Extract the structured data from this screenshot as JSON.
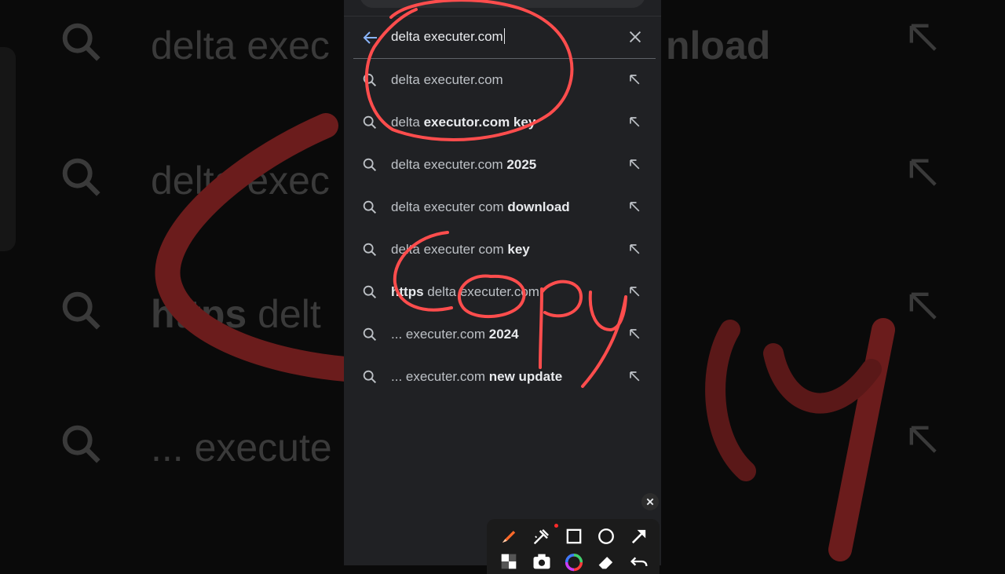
{
  "search": {
    "query": "delta executer.com"
  },
  "suggestions": [
    {
      "normal": "delta executer.com",
      "bold": "",
      "after": ""
    },
    {
      "normal": "delta ",
      "bold": "executor.com key",
      "after": ""
    },
    {
      "normal": "delta executer.com ",
      "bold": "2025",
      "after": ""
    },
    {
      "normal": "delta executer com ",
      "bold": "download",
      "after": ""
    },
    {
      "normal": "delta executer com ",
      "bold": "key",
      "after": ""
    },
    {
      "normal": "",
      "bold": "https",
      "after": " delta executer.com"
    },
    {
      "normal": "... executer.com ",
      "bold": "2024",
      "after": ""
    },
    {
      "normal": "... executer.com ",
      "bold": "new update",
      "after": ""
    }
  ],
  "background_text": {
    "row1": "delta exec",
    "row1_right": "nload",
    "row2": "delta exec",
    "row3_bold": "https",
    "row3": " delt",
    "row4": "... execute"
  },
  "annotation": {
    "handwritten_word": "Copy",
    "ink_color": "#ff4d4d"
  },
  "toolbar": {
    "tools": [
      "pen-icon",
      "highlighter-icon",
      "rectangle-icon",
      "circle-icon",
      "arrow-icon",
      "mosaic-icon",
      "camera-icon",
      "color-wheel-icon",
      "eraser-icon",
      "undo-icon"
    ]
  },
  "colors": {
    "background": "#202124",
    "text": "#bdc1c6",
    "accent": "#8ab4f8"
  }
}
